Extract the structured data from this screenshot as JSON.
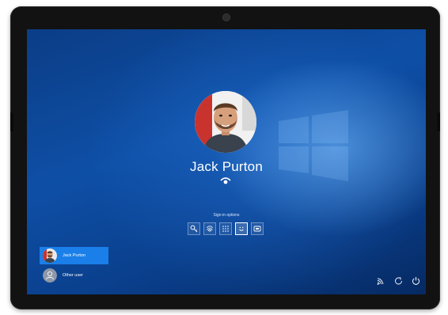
{
  "lock_screen": {
    "user_name": "Jack Purton",
    "signin_options_label": "Sign-in options",
    "signin_options": [
      {
        "icon": "key-icon",
        "selected": false
      },
      {
        "icon": "fingerprint-icon",
        "selected": false
      },
      {
        "icon": "pin-keypad-icon",
        "selected": false
      },
      {
        "icon": "face-icon",
        "selected": true
      },
      {
        "icon": "security-key-icon",
        "selected": false
      }
    ],
    "status_icon": "face-recognition-icon"
  },
  "user_switcher": {
    "users": [
      {
        "name": "Jack Purton",
        "active": true
      },
      {
        "name": "Other user",
        "active": false
      }
    ]
  },
  "system_tray": {
    "icons": [
      "network-icon",
      "accessibility-icon",
      "power-icon"
    ]
  },
  "colors": {
    "wallpaper": "#0e4fa6",
    "selected_user": "#1a7fe8",
    "bezel": "#121212"
  }
}
